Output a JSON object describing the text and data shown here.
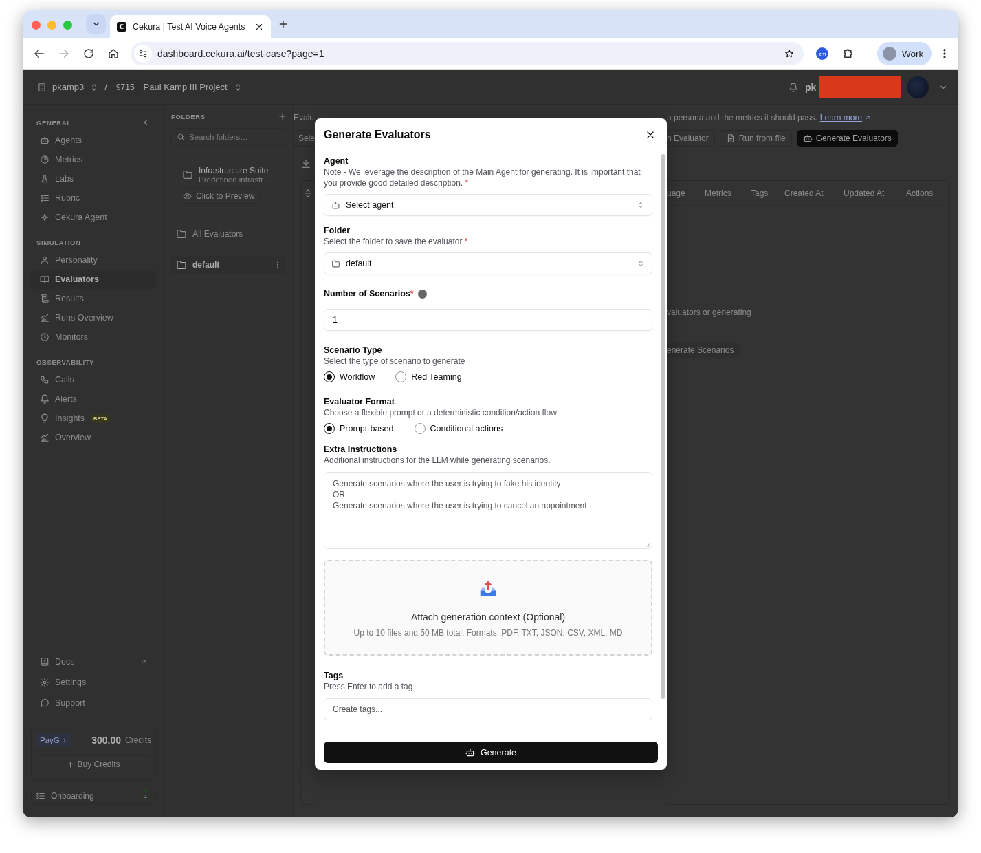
{
  "browser": {
    "tab_title": "Cekura | Test AI Voice Agents",
    "url": "dashboard.cekura.ai/test-case?page=1",
    "extension_label": "zm",
    "profile_name": "Work"
  },
  "topbar": {
    "org": "pkamp3",
    "separator": "/",
    "project_id": "9715",
    "project": "Paul Kamp III Project",
    "user": "pk"
  },
  "sidebar": {
    "sections": [
      {
        "title": "GENERAL",
        "items": [
          {
            "label": "Agents",
            "selected": false
          },
          {
            "label": "Metrics",
            "selected": false
          },
          {
            "label": "Labs",
            "selected": false
          },
          {
            "label": "Rubric",
            "selected": false
          },
          {
            "label": "Cekura Agent",
            "selected": false
          }
        ]
      },
      {
        "title": "SIMULATION",
        "items": [
          {
            "label": "Personality",
            "selected": false
          },
          {
            "label": "Evaluators",
            "selected": true
          },
          {
            "label": "Results",
            "selected": false
          },
          {
            "label": "Runs Overview",
            "selected": false
          },
          {
            "label": "Monitors",
            "selected": false
          }
        ]
      },
      {
        "title": "OBSERVABILITY",
        "items": [
          {
            "label": "Calls",
            "selected": false
          },
          {
            "label": "Alerts",
            "selected": false
          },
          {
            "label": "Insights",
            "selected": false,
            "badge": "BETA"
          },
          {
            "label": "Overview",
            "selected": false
          }
        ]
      }
    ],
    "footer_items": [
      {
        "label": "Docs",
        "external": true
      },
      {
        "label": "Settings",
        "external": false
      },
      {
        "label": "Support",
        "external": false
      }
    ],
    "credits": {
      "plan": "PayG",
      "amount": "300.00",
      "unit": "Credits",
      "buy_label": "Buy Credits"
    },
    "onboarding": {
      "label": "Onboarding",
      "count": "1"
    }
  },
  "folders": {
    "title": "FOLDERS",
    "search_placeholder": "Search folders…",
    "featured": {
      "name": "Infrastructure Suite",
      "description": "Predefined infrastr…",
      "preview_label": "Click to Preview"
    },
    "items": [
      {
        "name": "All Evaluators",
        "selected": false
      },
      {
        "name": "default",
        "selected": true
      }
    ]
  },
  "main": {
    "description_left": "Evalu",
    "description_right": "a persona and the metrics it should pass.",
    "learn_more": "Learn more",
    "select_partial": "Sele",
    "buttons": [
      {
        "label": "n Evaluator",
        "kind": "plain"
      },
      {
        "label": "Run from file",
        "kind": "file"
      },
      {
        "label": "Generate Evaluators",
        "kind": "primary"
      }
    ],
    "table_columns": [
      "uage",
      "Metrics",
      "Tags",
      "Created At",
      "Updated At",
      "Actions"
    ],
    "empty_text": "valuators or generating",
    "empty_button": "enerate Scenarios"
  },
  "modal": {
    "title": "Generate Evaluators",
    "sections": [
      {
        "kind": "select",
        "label": "Agent",
        "description": "Note - We leverage the description of the Main Agent for generating. It is important that you provide good detailed description.",
        "required_mark": "*",
        "value": "Select agent"
      },
      {
        "kind": "select",
        "label": "Folder",
        "description": "Select the folder to save the evaluator",
        "required_mark": "*",
        "value": "default"
      },
      {
        "kind": "number",
        "label": "Number of Scenarios",
        "required_mark": "*",
        "value": "1"
      },
      {
        "kind": "radio",
        "label": "Scenario Type",
        "description": "Select the type of scenario to generate",
        "options": [
          {
            "label": "Workflow",
            "selected": true
          },
          {
            "label": "Red Teaming",
            "selected": false
          }
        ]
      },
      {
        "kind": "radio",
        "label": "Evaluator Format",
        "description": "Choose a flexible prompt or a deterministic condition/action flow",
        "options": [
          {
            "label": "Prompt-based",
            "selected": true
          },
          {
            "label": "Conditional actions",
            "selected": false
          }
        ]
      },
      {
        "kind": "textarea",
        "label": "Extra Instructions",
        "description": "Additional instructions for the LLM while generating scenarios.",
        "value": "Generate scenarios where the user is trying to fake his identity\nOR\nGenerate scenarios where the user is trying to cancel an appointment"
      },
      {
        "kind": "upload",
        "title": "Attach generation context (Optional)",
        "hint": "Up to 10 files and 50 MB total. Formats: PDF, TXT, JSON, CSV, XML, MD"
      },
      {
        "kind": "tags",
        "label": "Tags",
        "description": "Press Enter to add a tag",
        "placeholder": "Create tags..."
      }
    ],
    "submit_label": "Generate"
  }
}
